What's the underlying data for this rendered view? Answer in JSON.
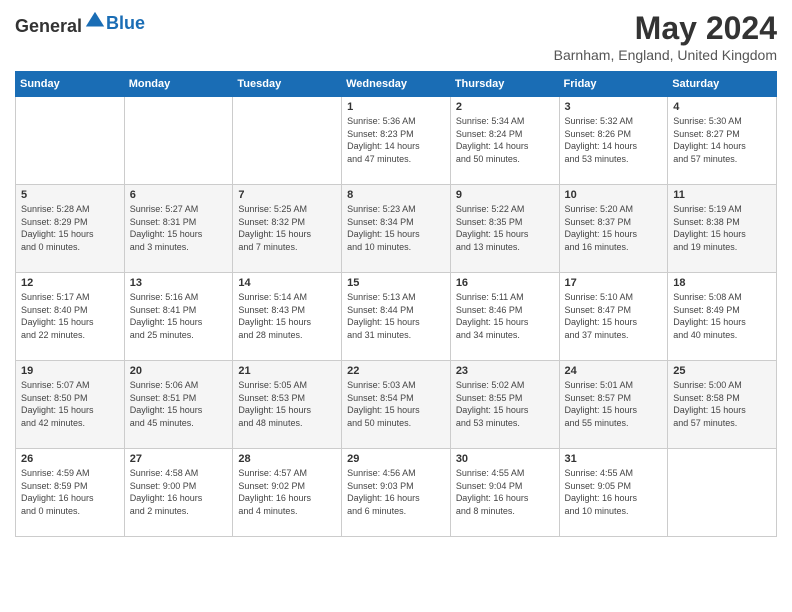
{
  "header": {
    "logo_general": "General",
    "logo_blue": "Blue",
    "month_year": "May 2024",
    "location": "Barnham, England, United Kingdom"
  },
  "days_of_week": [
    "Sunday",
    "Monday",
    "Tuesday",
    "Wednesday",
    "Thursday",
    "Friday",
    "Saturday"
  ],
  "weeks": [
    [
      {
        "day": "",
        "content": ""
      },
      {
        "day": "",
        "content": ""
      },
      {
        "day": "",
        "content": ""
      },
      {
        "day": "1",
        "content": "Sunrise: 5:36 AM\nSunset: 8:23 PM\nDaylight: 14 hours\nand 47 minutes."
      },
      {
        "day": "2",
        "content": "Sunrise: 5:34 AM\nSunset: 8:24 PM\nDaylight: 14 hours\nand 50 minutes."
      },
      {
        "day": "3",
        "content": "Sunrise: 5:32 AM\nSunset: 8:26 PM\nDaylight: 14 hours\nand 53 minutes."
      },
      {
        "day": "4",
        "content": "Sunrise: 5:30 AM\nSunset: 8:27 PM\nDaylight: 14 hours\nand 57 minutes."
      }
    ],
    [
      {
        "day": "5",
        "content": "Sunrise: 5:28 AM\nSunset: 8:29 PM\nDaylight: 15 hours\nand 0 minutes."
      },
      {
        "day": "6",
        "content": "Sunrise: 5:27 AM\nSunset: 8:31 PM\nDaylight: 15 hours\nand 3 minutes."
      },
      {
        "day": "7",
        "content": "Sunrise: 5:25 AM\nSunset: 8:32 PM\nDaylight: 15 hours\nand 7 minutes."
      },
      {
        "day": "8",
        "content": "Sunrise: 5:23 AM\nSunset: 8:34 PM\nDaylight: 15 hours\nand 10 minutes."
      },
      {
        "day": "9",
        "content": "Sunrise: 5:22 AM\nSunset: 8:35 PM\nDaylight: 15 hours\nand 13 minutes."
      },
      {
        "day": "10",
        "content": "Sunrise: 5:20 AM\nSunset: 8:37 PM\nDaylight: 15 hours\nand 16 minutes."
      },
      {
        "day": "11",
        "content": "Sunrise: 5:19 AM\nSunset: 8:38 PM\nDaylight: 15 hours\nand 19 minutes."
      }
    ],
    [
      {
        "day": "12",
        "content": "Sunrise: 5:17 AM\nSunset: 8:40 PM\nDaylight: 15 hours\nand 22 minutes."
      },
      {
        "day": "13",
        "content": "Sunrise: 5:16 AM\nSunset: 8:41 PM\nDaylight: 15 hours\nand 25 minutes."
      },
      {
        "day": "14",
        "content": "Sunrise: 5:14 AM\nSunset: 8:43 PM\nDaylight: 15 hours\nand 28 minutes."
      },
      {
        "day": "15",
        "content": "Sunrise: 5:13 AM\nSunset: 8:44 PM\nDaylight: 15 hours\nand 31 minutes."
      },
      {
        "day": "16",
        "content": "Sunrise: 5:11 AM\nSunset: 8:46 PM\nDaylight: 15 hours\nand 34 minutes."
      },
      {
        "day": "17",
        "content": "Sunrise: 5:10 AM\nSunset: 8:47 PM\nDaylight: 15 hours\nand 37 minutes."
      },
      {
        "day": "18",
        "content": "Sunrise: 5:08 AM\nSunset: 8:49 PM\nDaylight: 15 hours\nand 40 minutes."
      }
    ],
    [
      {
        "day": "19",
        "content": "Sunrise: 5:07 AM\nSunset: 8:50 PM\nDaylight: 15 hours\nand 42 minutes."
      },
      {
        "day": "20",
        "content": "Sunrise: 5:06 AM\nSunset: 8:51 PM\nDaylight: 15 hours\nand 45 minutes."
      },
      {
        "day": "21",
        "content": "Sunrise: 5:05 AM\nSunset: 8:53 PM\nDaylight: 15 hours\nand 48 minutes."
      },
      {
        "day": "22",
        "content": "Sunrise: 5:03 AM\nSunset: 8:54 PM\nDaylight: 15 hours\nand 50 minutes."
      },
      {
        "day": "23",
        "content": "Sunrise: 5:02 AM\nSunset: 8:55 PM\nDaylight: 15 hours\nand 53 minutes."
      },
      {
        "day": "24",
        "content": "Sunrise: 5:01 AM\nSunset: 8:57 PM\nDaylight: 15 hours\nand 55 minutes."
      },
      {
        "day": "25",
        "content": "Sunrise: 5:00 AM\nSunset: 8:58 PM\nDaylight: 15 hours\nand 57 minutes."
      }
    ],
    [
      {
        "day": "26",
        "content": "Sunrise: 4:59 AM\nSunset: 8:59 PM\nDaylight: 16 hours\nand 0 minutes."
      },
      {
        "day": "27",
        "content": "Sunrise: 4:58 AM\nSunset: 9:00 PM\nDaylight: 16 hours\nand 2 minutes."
      },
      {
        "day": "28",
        "content": "Sunrise: 4:57 AM\nSunset: 9:02 PM\nDaylight: 16 hours\nand 4 minutes."
      },
      {
        "day": "29",
        "content": "Sunrise: 4:56 AM\nSunset: 9:03 PM\nDaylight: 16 hours\nand 6 minutes."
      },
      {
        "day": "30",
        "content": "Sunrise: 4:55 AM\nSunset: 9:04 PM\nDaylight: 16 hours\nand 8 minutes."
      },
      {
        "day": "31",
        "content": "Sunrise: 4:55 AM\nSunset: 9:05 PM\nDaylight: 16 hours\nand 10 minutes."
      },
      {
        "day": "",
        "content": ""
      }
    ]
  ]
}
